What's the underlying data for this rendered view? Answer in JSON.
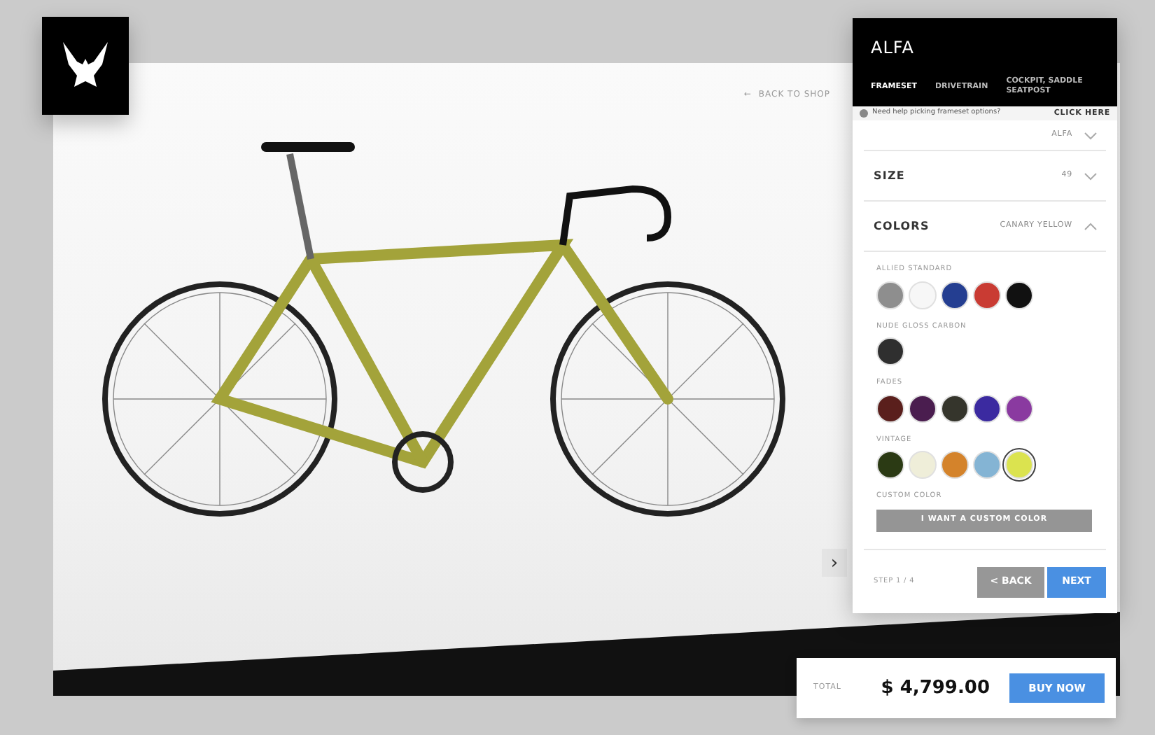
{
  "back_link": {
    "arrow": "←",
    "label": "BACK TO SHOP"
  },
  "panel": {
    "title": "ALFA",
    "tabs": [
      {
        "label": "FRAMESET",
        "selected": true
      },
      {
        "label": "DRIVETRAIN",
        "selected": false
      },
      {
        "label": "COCKPIT, SADDLE SEATPOST",
        "selected": false
      }
    ],
    "help": {
      "text": "Need help picking frameset options?",
      "link": "CLICK HERE"
    },
    "options": [
      {
        "value": "ALFA",
        "expanded": false
      },
      {
        "label": "SIZE",
        "value": "49",
        "expanded": false
      },
      {
        "label": "COLORS",
        "value": "CANARY YELLOW",
        "expanded": true
      }
    ],
    "color_groups": [
      {
        "title": "ALLIED STANDARD",
        "swatches": [
          {
            "color": "#8e8e8e",
            "selected": false
          },
          {
            "color": "#f7f7f7",
            "selected": false
          },
          {
            "color": "#243e91",
            "selected": false
          },
          {
            "color": "#c93b33",
            "selected": false
          },
          {
            "color": "#111111",
            "selected": false
          }
        ]
      },
      {
        "title": "NUDE GLOSS CARBON",
        "swatches": [
          {
            "color": "#2f2f2f",
            "selected": false
          }
        ]
      },
      {
        "title": "FADES",
        "swatches": [
          {
            "color": "#5a1f1c",
            "selected": false
          },
          {
            "color": "#4a1d4f",
            "selected": false
          },
          {
            "color": "#35352c",
            "selected": false
          },
          {
            "color": "#3b2aa0",
            "selected": false
          },
          {
            "color": "#8a3aa0",
            "selected": false
          }
        ]
      },
      {
        "title": "VINTAGE",
        "swatches": [
          {
            "color": "#2b3a14",
            "selected": false
          },
          {
            "color": "#efeed9",
            "selected": false
          },
          {
            "color": "#d4832b",
            "selected": false
          },
          {
            "color": "#84b4d4",
            "selected": false
          },
          {
            "color": "#dbe34f",
            "selected": true
          }
        ]
      }
    ],
    "custom": {
      "title": "CUSTOM COLOR",
      "button": "I WANT A CUSTOM COLOR"
    },
    "step": "STEP 1 / 4",
    "back_button": {
      "arrow": "<",
      "label": "BACK"
    },
    "next_button": "NEXT"
  },
  "next_image": "›",
  "total": {
    "label": "TOTAL",
    "price": "$ 4,799.00",
    "button": "BUY NOW"
  }
}
